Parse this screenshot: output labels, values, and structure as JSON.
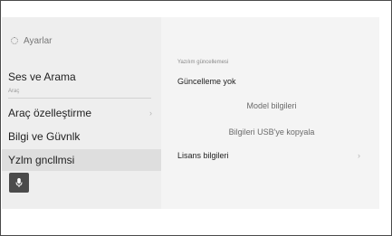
{
  "sidebar": {
    "header_label": "Ayarlar",
    "items": [
      {
        "label": "Ses ve Arama"
      },
      {
        "label": "Araç özelleştirme"
      },
      {
        "label": "Bilgi ve Güvnlk"
      },
      {
        "label": "Yzlm gncllmsi"
      }
    ],
    "section_label": "Araç",
    "selected_index": 3
  },
  "content": {
    "section_label": "Yazılım güncellemesi",
    "status_text": "Güncelleme yok",
    "model_info_label": "Model bilgileri",
    "copy_usb_label": "Bilgileri USB'ye kopyala",
    "license_label": "Lisans bilgileri"
  },
  "icons": {
    "header": "gear-icon",
    "voice": "microphone-icon",
    "chevron": "chevron-right-icon"
  },
  "colors": {
    "sidebar_bg": "#eeeeee",
    "selected_bg": "#dedede",
    "content_bg": "#f4f4f4",
    "mic_button_bg": "#4b4b4b"
  }
}
